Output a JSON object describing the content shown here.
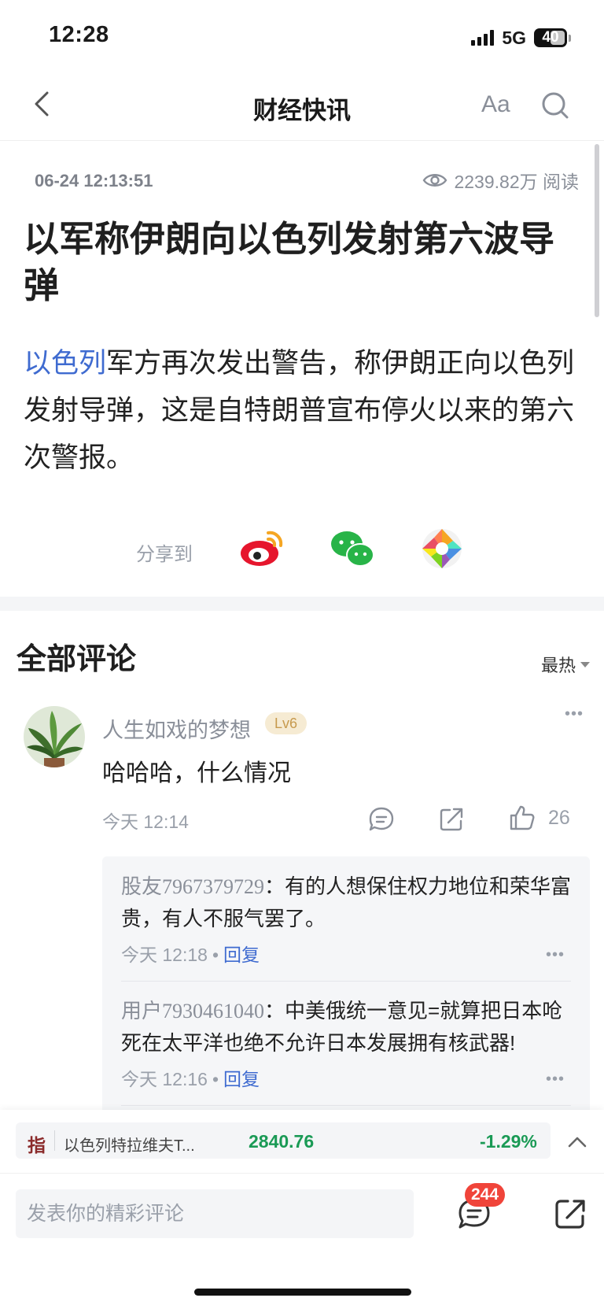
{
  "status_bar": {
    "time": "12:28",
    "network": "5G",
    "battery": "40"
  },
  "nav": {
    "title": "财经快讯",
    "font_button": "Aa"
  },
  "article": {
    "time": "06-24 12:13:51",
    "views": "2239.82万 阅读",
    "headline": "以军称伊朗向以色列发射第六波导弹",
    "body_link": "以色列",
    "body_rest": "军方再次发出警告，称伊朗正向以色列发射导弹，这是自特朗普宣布停火以来的第六次警报。",
    "share_label": "分享到",
    "share_targets": [
      "weibo-icon",
      "wechat-icon",
      "moments-icon"
    ]
  },
  "comments": {
    "title": "全部评论",
    "sort_label": "最热",
    "items": [
      {
        "user": "人生如戏的梦想",
        "level": "Lv6",
        "text": "哈哈哈，什么情况",
        "time": "今天 12:14",
        "likes": "26",
        "replies": [
          {
            "user": "股友7967379729",
            "sep": "：",
            "text": "有的人想保住权力地位和荣华富贵，有人不服气罢了。",
            "time": "今天 12:18",
            "dot": "•",
            "reply_label": "回复"
          },
          {
            "user": "用户7930461040",
            "sep": "：",
            "text": "中美俄统一意见=就算把日本呛死在太平洋也绝不允许日本发展拥有核武器!",
            "time": "今天 12:16",
            "dot": "•",
            "reply_label": "回复"
          }
        ]
      }
    ]
  },
  "ticker": {
    "badge": "指",
    "name": "以色列特拉维夫T...",
    "price": "2840.76",
    "change": "-1.29%"
  },
  "composer": {
    "placeholder": "发表你的精彩评论",
    "comment_count": "244"
  },
  "colors": {
    "link": "#3f6bd0",
    "down": "#1a9a55",
    "badge": "#f0443a"
  }
}
